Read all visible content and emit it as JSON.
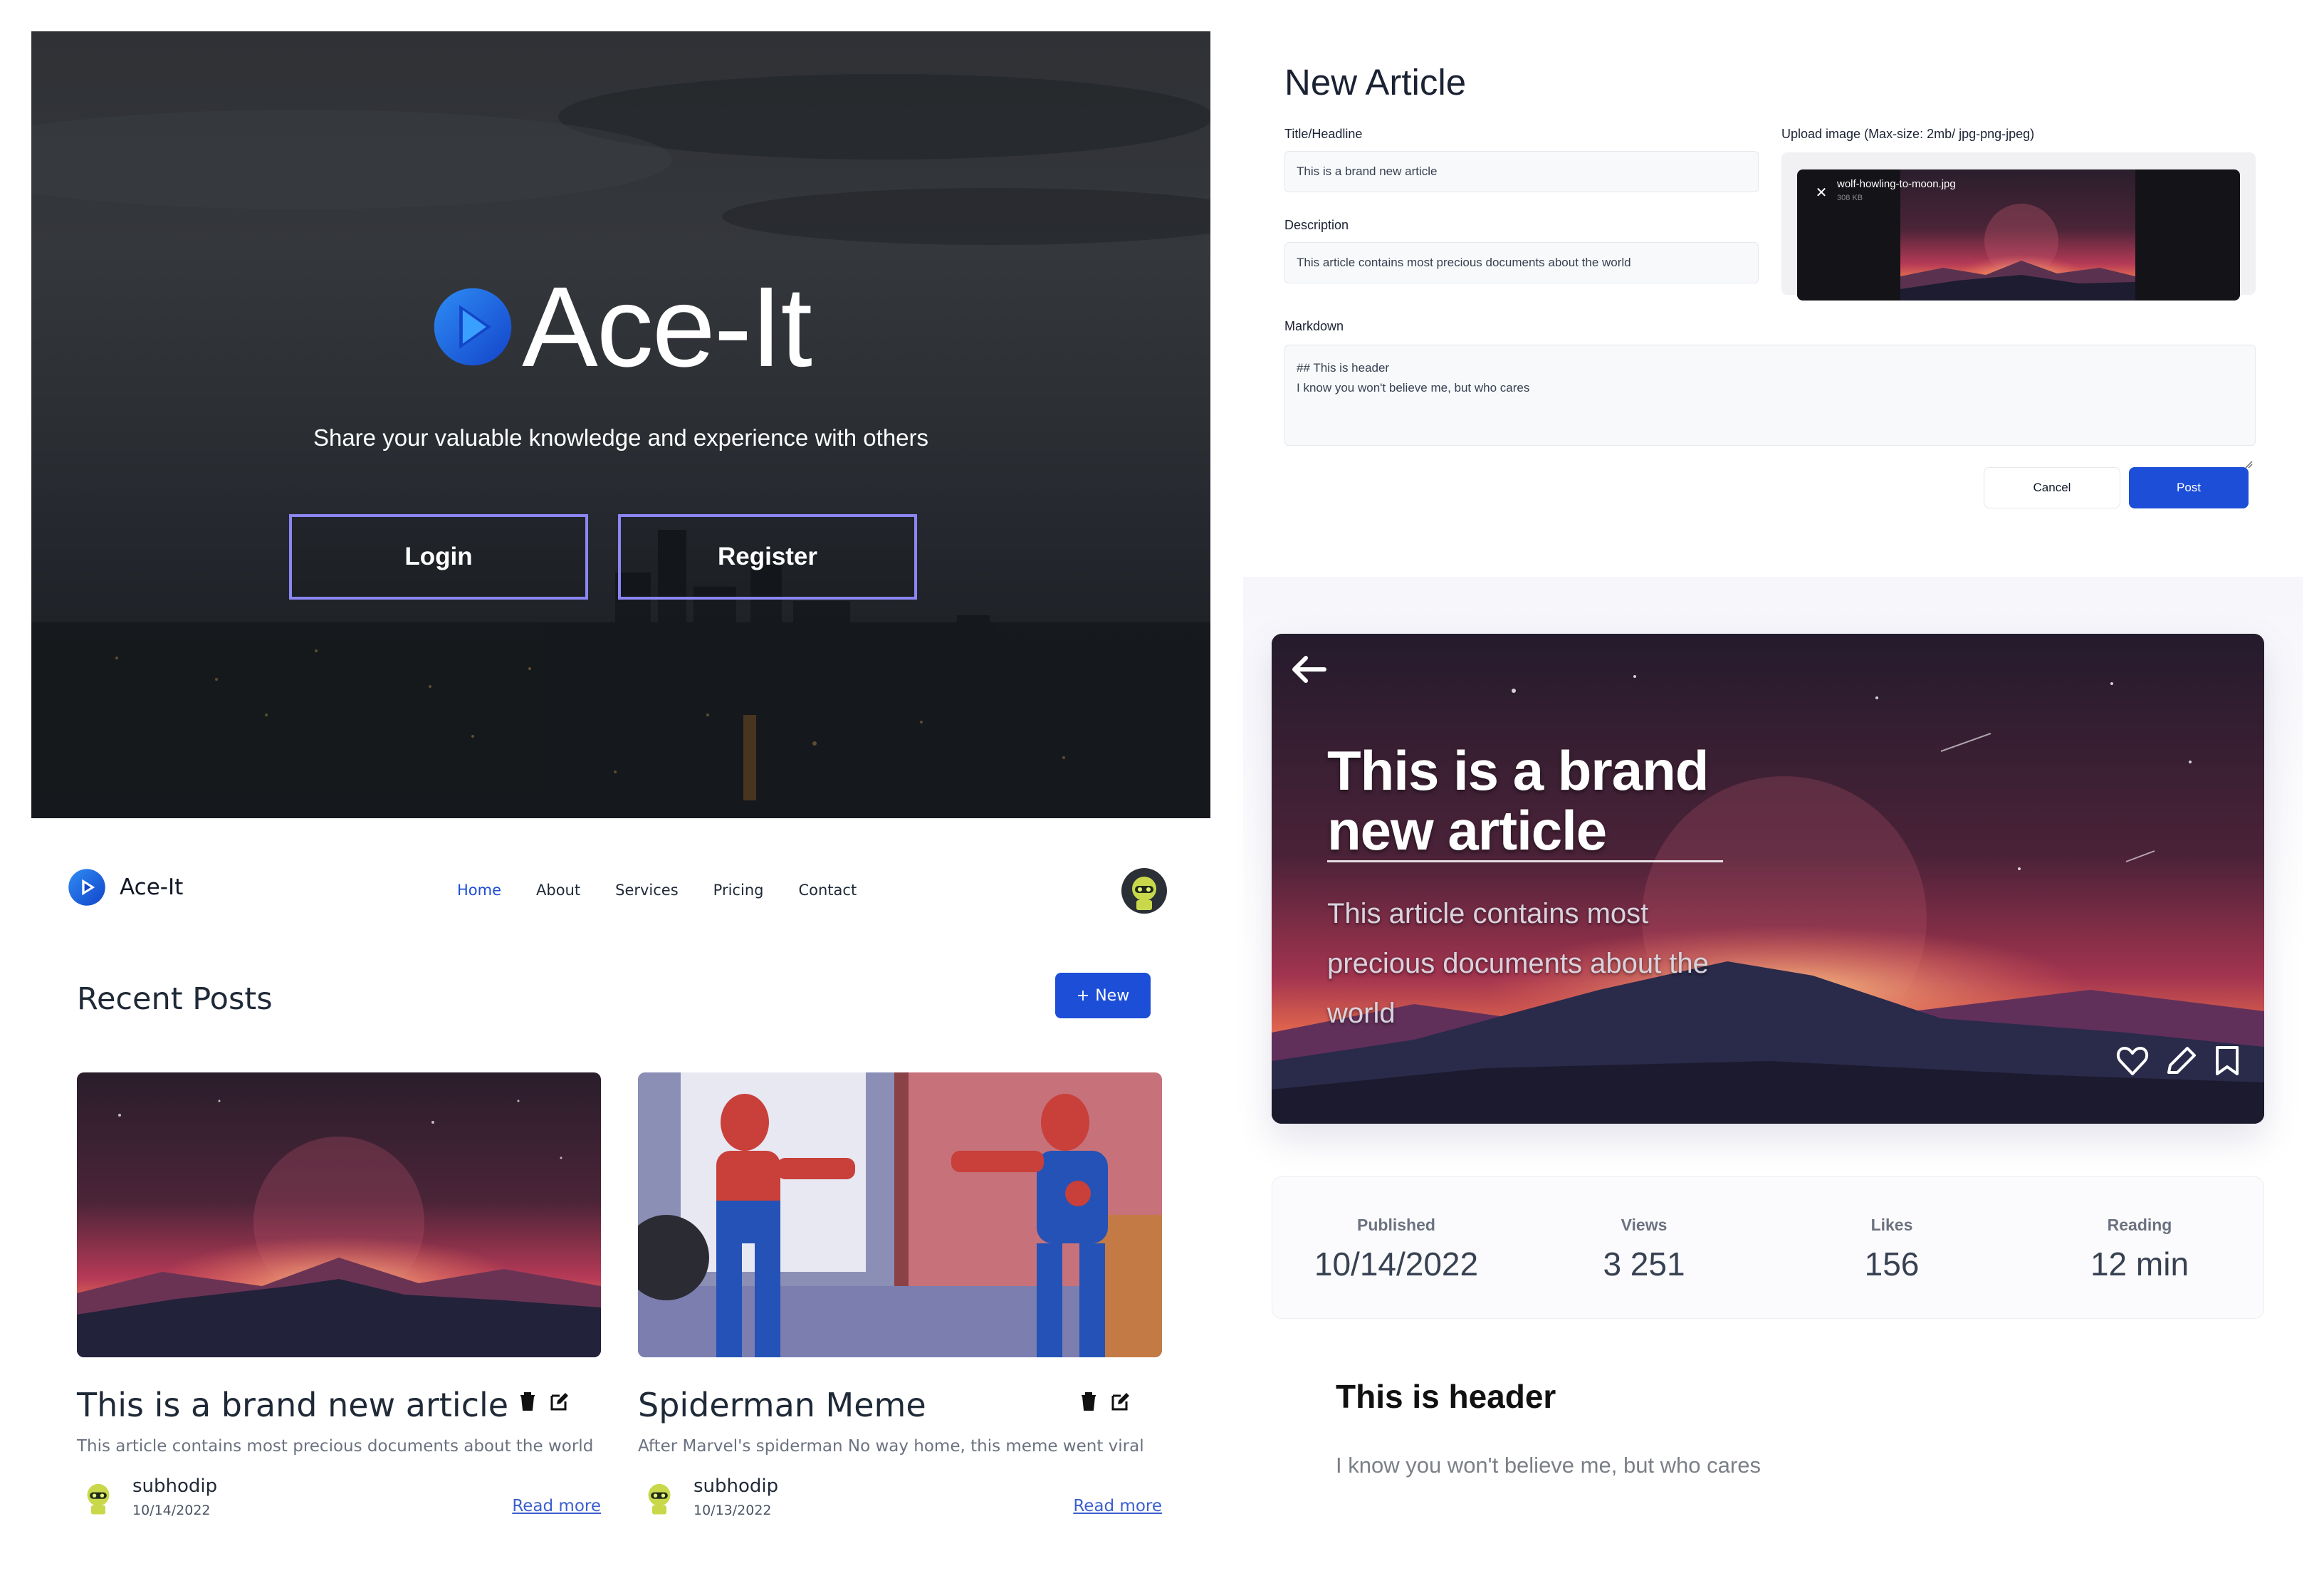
{
  "landing": {
    "app_name": "Ace-It",
    "tagline": "Share your valuable knowledge and experience with others",
    "login_label": "Login",
    "register_label": "Register"
  },
  "new_article_form": {
    "heading": "New Article",
    "title_label": "Title/Headline",
    "title_value": "This is a brand new article",
    "description_label": "Description",
    "description_value": "This article contains most precious documents about the world",
    "upload_label": "Upload image (Max-size: 2mb/ jpg-png-jpeg)",
    "upload_file_name": "wolf-howling-to-moon.jpg",
    "upload_file_size": "308 KB",
    "markdown_label": "Markdown",
    "markdown_lines": [
      "## This is header",
      "I know you won't believe me, but who cares"
    ],
    "cancel_label": "Cancel",
    "post_label": "Post"
  },
  "blog": {
    "brand_name": "Ace-It",
    "nav": [
      {
        "label": "Home",
        "active": true
      },
      {
        "label": "About",
        "active": false
      },
      {
        "label": "Services",
        "active": false
      },
      {
        "label": "Pricing",
        "active": false
      },
      {
        "label": "Contact",
        "active": false
      }
    ],
    "section_title": "Recent Posts",
    "new_button_label": "New",
    "posts": [
      {
        "title": "This is a brand new article",
        "description": "This article contains most precious documents about the world",
        "author": "subhodip",
        "date": "10/14/2022",
        "read_more": "Read more"
      },
      {
        "title": "Spiderman Meme",
        "description": "After Marvel's spiderman No way home, this meme went viral",
        "author": "subhodip",
        "date": "10/13/2022",
        "read_more": "Read more"
      }
    ]
  },
  "article_detail": {
    "title": "This is a brand new article",
    "description": "This article contains most precious documents about the world",
    "stats": [
      {
        "label": "Published",
        "value": "10/14/2022"
      },
      {
        "label": "Views",
        "value": "3 251"
      },
      {
        "label": "Likes",
        "value": "156"
      },
      {
        "label": "Reading",
        "value": "12 min"
      }
    ],
    "markdown_heading": "This is header",
    "markdown_paragraph": "I know you won't believe me, but who cares"
  },
  "colors": {
    "primary": "#1d4ed8",
    "hero_button_border": "#8b86f2",
    "link": "#3b5fcf"
  }
}
